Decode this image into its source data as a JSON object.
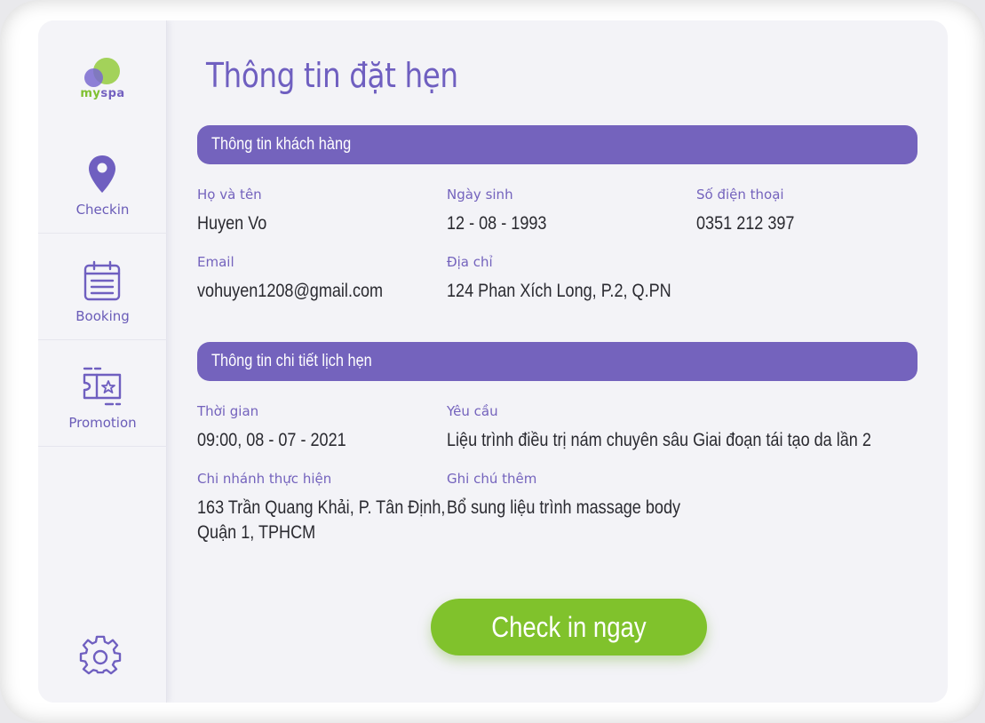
{
  "brand": {
    "logo_my": "my",
    "logo_spa": "spa"
  },
  "sidebar": {
    "items": [
      {
        "label": "Checkin",
        "icon": "map-pin-icon"
      },
      {
        "label": "Booking",
        "icon": "calendar-icon"
      },
      {
        "label": "Promotion",
        "icon": "ticket-star-icon"
      }
    ],
    "settings_icon": "gear-icon"
  },
  "page": {
    "title": "Thông tin đặt hẹn"
  },
  "customer": {
    "section_title": "Thông tin khách hàng",
    "name_label": "Họ và tên",
    "name_value": "Huyen Vo",
    "dob_label": "Ngày sinh",
    "dob_value": "12 - 08 - 1993",
    "phone_label": "Số điện thoại",
    "phone_value": "0351 212 397",
    "email_label": "Email",
    "email_value": "vohuyen1208@gmail.com",
    "address_label": "Địa chỉ",
    "address_value": "124 Phan Xích Long, P.2, Q.PN"
  },
  "appointment": {
    "section_title": "Thông tin chi tiết lịch hẹn",
    "time_label": "Thời gian",
    "time_value": "09:00, 08 - 07 - 2021",
    "request_label": "Yêu cầu",
    "request_value": "Liệu trình điều trị nám chuyên sâu Giai đoạn tái tạo da lần 2",
    "branch_label": "Chi nhánh thực hiện",
    "branch_value_line1": "163 Trần Quang Khải, P. Tân Định,",
    "branch_value_line2": "Quận 1, TPHCM",
    "note_label": "Ghi chú thêm",
    "note_value": "Bổ sung liệu trình massage body"
  },
  "actions": {
    "checkin_label": "Check in ngay"
  },
  "colors": {
    "accent": "#7463bd",
    "button": "#80c22c",
    "logo_green": "#a3d25a"
  }
}
